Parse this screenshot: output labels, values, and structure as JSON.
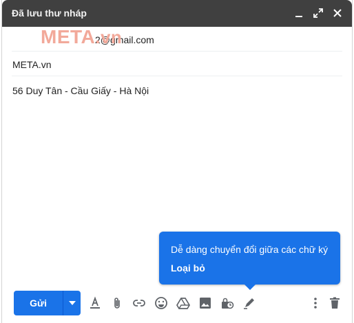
{
  "window": {
    "title": "Đã lưu thư nháp"
  },
  "fields": {
    "to_value": "2@gmail.com",
    "subject_value": "META.vn"
  },
  "watermark": {
    "main": "META",
    "suffix": ".vn"
  },
  "body": {
    "text": "56 Duy Tân - Cầu Giấy - Hà Nội"
  },
  "tooltip": {
    "message": "Dễ dàng chuyển đổi giữa các chữ ký",
    "dismiss": "Loại bỏ"
  },
  "toolbar": {
    "send_label": "Gửi",
    "icons": [
      "formatting-icon",
      "attach-icon",
      "link-icon",
      "emoji-icon",
      "drive-icon",
      "photo-icon",
      "confidential-icon",
      "signature-icon",
      "more-options-icon",
      "discard-icon"
    ]
  },
  "colors": {
    "titlebar": "#404040",
    "accent": "#1a73e8"
  }
}
